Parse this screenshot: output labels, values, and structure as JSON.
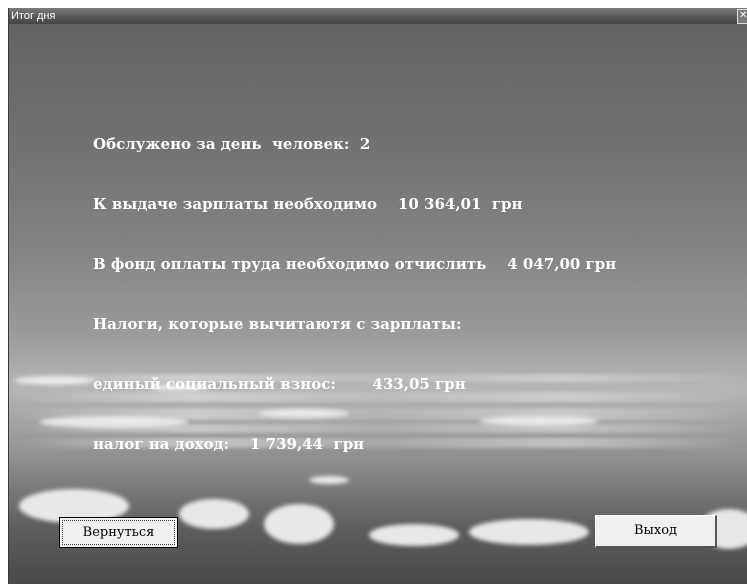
{
  "window": {
    "title": "Итог дня",
    "close_glyph": "✕"
  },
  "summary": {
    "lines": [
      "Обслужено за день  человек:  2",
      "К выдаче зарплаты необходимо    10 364,01  грн",
      "В фонд оплаты труда необходимо отчислить    4 047,00 грн",
      "Налоги, которые вычитаютя с зарплаты:",
      "единый социальный взнос:       433,05 грн",
      "налог на доход:    1 739,44  грн"
    ]
  },
  "buttons": {
    "back_label": "Вернуться",
    "exit_label": "Выход"
  }
}
